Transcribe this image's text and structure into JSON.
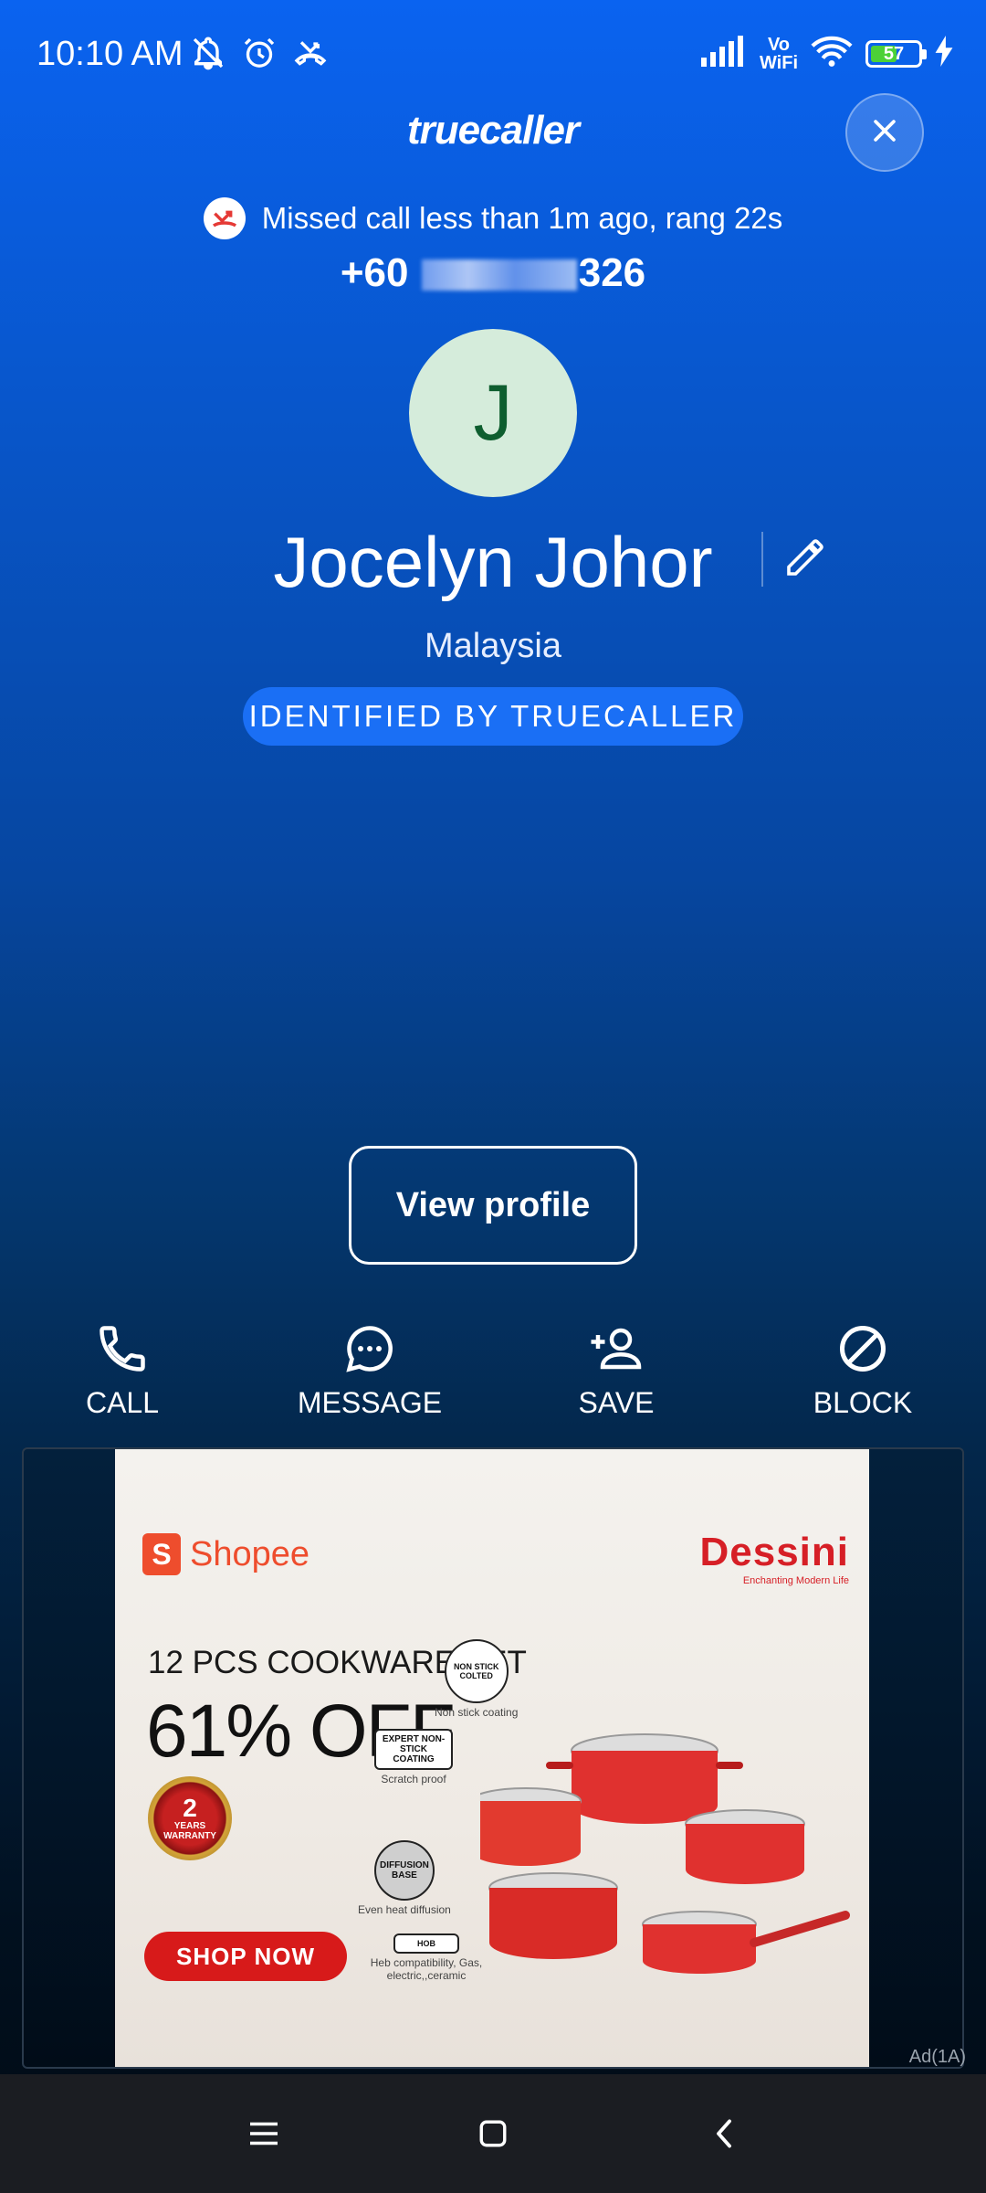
{
  "status_bar": {
    "time": "10:10 AM",
    "left_icons": [
      "notifications-off-icon",
      "alarm-icon",
      "missed-call-icon"
    ],
    "right_icons": [
      "signal-icon",
      "vowifi-icon",
      "wifi-icon",
      "battery-icon",
      "charging-icon"
    ],
    "vowifi_top": "Vo",
    "vowifi_bottom": "WiFi",
    "battery_level": "57",
    "battery_fraction": 0.57
  },
  "header": {
    "brand": "truecaller",
    "close_icon": "close-icon"
  },
  "caller": {
    "missed_text": "Missed call less than 1m ago, rang 22s",
    "phone_prefix": "+60 ",
    "phone_suffix": "326",
    "avatar_letter": "J",
    "name": "Jocelyn Johor",
    "country": "Malaysia",
    "badge": "IDENTIFIED BY TRUECALLER"
  },
  "view_profile_label": "View profile",
  "actions": [
    {
      "label": "CALL",
      "icon": "phone-icon"
    },
    {
      "label": "MESSAGE",
      "icon": "chat-bubble-icon"
    },
    {
      "label": "SAVE",
      "icon": "add-contact-icon"
    },
    {
      "label": "BLOCK",
      "icon": "block-icon"
    }
  ],
  "ad": {
    "shopee": "Shopee",
    "dessini": "Dessini",
    "dessini_tagline": "Enchanting Modern Life",
    "headline": "12 PCS COOKWARE SET",
    "discount": "61% OFF",
    "warranty_num": "2",
    "warranty_text1": "YEARS",
    "warranty_text2": "WARRANTY",
    "shop_now": "SHOP NOW",
    "features": [
      {
        "badge": "NON STICK COLTED",
        "caption": "Non stick coating"
      },
      {
        "badge": "EXPERT NON-STICK COATING",
        "caption": "Scratch proof"
      },
      {
        "badge": "DIFFUSION BASE",
        "caption": "Even heat diffusion"
      },
      {
        "badge": "HOB",
        "caption": "Heb compatibility, Gas, electric,,ceramic"
      }
    ],
    "ad_label": "Ad(1A)",
    "colors": {
      "shopee": "#ee4d2d",
      "dessini": "#d61f26",
      "pot": "#e0312f"
    }
  },
  "nav": {
    "menu_icon": "menu-icon",
    "home_icon": "home-square-icon",
    "back_icon": "back-chevron-icon"
  },
  "colors": {
    "gradient_top": "#0a63f0",
    "badge_bg": "#1a6ff5",
    "avatar_bg": "#d5ecdb",
    "avatar_fg": "#0e5e2f"
  }
}
